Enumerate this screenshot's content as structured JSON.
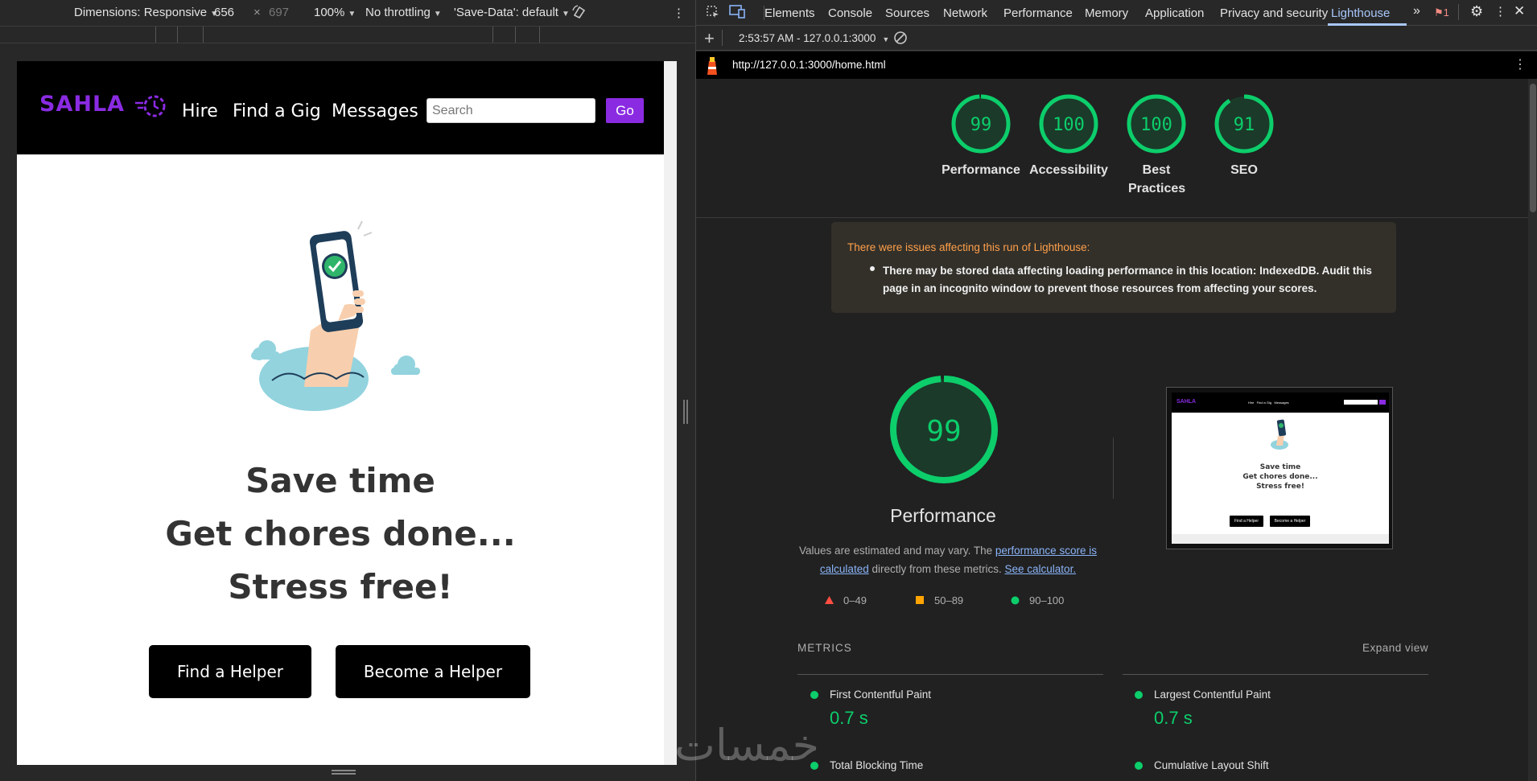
{
  "device_toolbar": {
    "dimensions": "Dimensions: Responsive",
    "width": "656",
    "times": "×",
    "height": "697",
    "zoom": "100%",
    "throttling": "No throttling",
    "save_data": "'Save-Data': default",
    "more_icon": "more-vert-icon"
  },
  "site": {
    "logo": "SAHLA",
    "nav": [
      "Hire",
      "Find a Gig",
      "Messages"
    ],
    "search_placeholder": "Search",
    "go": "Go",
    "hero_lines": [
      "Save time",
      "Get chores done...",
      "Stress free!"
    ],
    "cta_primary": "Find a Helper",
    "cta_secondary": "Become a Helper",
    "brand_color": "#8a2be2"
  },
  "devtools": {
    "tabs": [
      "Elements",
      "Console",
      "Sources",
      "Network",
      "Performance",
      "Memory",
      "Application",
      "Privacy and security",
      "Lighthouse"
    ],
    "active_tab": "Lighthouse",
    "issues_count": "1",
    "report_time": "2:53:57 AM - 127.0.0.1:3000",
    "url": "http://127.0.0.1:3000/home.html"
  },
  "scores": [
    {
      "label": "Performance",
      "value": 99
    },
    {
      "label": "Accessibility",
      "value": 100
    },
    {
      "label": "Best Practices",
      "value": 100
    },
    {
      "label": "SEO",
      "value": 91
    }
  ],
  "warning": {
    "title": "There were issues affecting this run of Lighthouse:",
    "text": "There may be stored data affecting loading performance in this location: IndexedDB. Audit this page in an incognito window to prevent those resources from affecting your scores."
  },
  "performance": {
    "score": "99",
    "title": "Performance",
    "desc_prefix": "Values are estimated and may vary. The ",
    "desc_link1": "performance score is calculated",
    "desc_middle": " directly from these metrics. ",
    "desc_link2": "See calculator.",
    "legend": [
      "0–49",
      "50–89",
      "90–100"
    ],
    "legend_colors": [
      "#ff4e42",
      "#ffa400",
      "#0cce6b"
    ]
  },
  "thumbnail": {
    "logo": "SAHLA",
    "nav": "Hire   Find a Gig   Messages",
    "lines": [
      "Save time",
      "Get chores done...",
      "Stress free!"
    ],
    "btn1": "Find a Helper",
    "btn2": "Become a Helper"
  },
  "metrics": {
    "header": "METRICS",
    "expand": "Expand view",
    "items": [
      {
        "name": "First Contentful Paint",
        "value": "0.7 s"
      },
      {
        "name": "Largest Contentful Paint",
        "value": "0.7 s"
      },
      {
        "name": "Total Blocking Time",
        "value": ""
      },
      {
        "name": "Cumulative Layout Shift",
        "value": ""
      }
    ]
  },
  "watermark": "خمسات"
}
